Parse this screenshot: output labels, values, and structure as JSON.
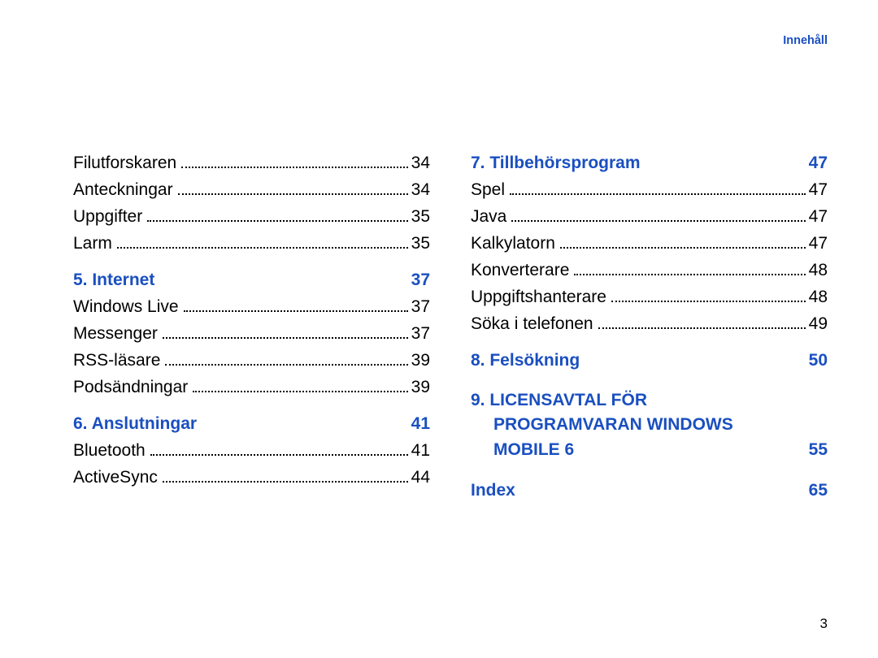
{
  "header": {
    "label": "Innehåll"
  },
  "footer": {
    "page_number": "3"
  },
  "left_column": [
    {
      "type": "entry",
      "label": "Filutforskaren",
      "page": "34"
    },
    {
      "type": "entry",
      "label": "Anteckningar",
      "page": "34"
    },
    {
      "type": "entry",
      "label": "Uppgifter",
      "page": "35"
    },
    {
      "type": "entry",
      "label": "Larm",
      "page": "35"
    },
    {
      "type": "section",
      "label": "5. Internet",
      "page": "37"
    },
    {
      "type": "entry",
      "label": "Windows Live",
      "page": "37"
    },
    {
      "type": "entry",
      "label": "Messenger",
      "page": "37"
    },
    {
      "type": "entry",
      "label": "RSS-läsare",
      "page": "39"
    },
    {
      "type": "entry",
      "label": "Podsändningar",
      "page": "39"
    },
    {
      "type": "section",
      "label": "6. Anslutningar",
      "page": "41"
    },
    {
      "type": "entry",
      "label": "Bluetooth",
      "page": "41"
    },
    {
      "type": "entry",
      "label": "ActiveSync",
      "page": "44"
    }
  ],
  "right_column": [
    {
      "type": "section",
      "label": "7. Tillbehörsprogram",
      "page": "47"
    },
    {
      "type": "entry",
      "label": "Spel",
      "page": "47"
    },
    {
      "type": "entry",
      "label": "Java",
      "page": "47"
    },
    {
      "type": "entry",
      "label": "Kalkylatorn",
      "page": "47"
    },
    {
      "type": "entry",
      "label": "Konverterare",
      "page": "48"
    },
    {
      "type": "entry",
      "label": "Uppgiftshanterare",
      "page": "48"
    },
    {
      "type": "entry",
      "label": "Söka i telefonen",
      "page": "49"
    },
    {
      "type": "section",
      "label": "8. Felsökning",
      "page": "50"
    },
    {
      "type": "section_multiline",
      "lines": [
        "9. LICENSAVTAL FÖR",
        "PROGRAMVARAN WINDOWS"
      ],
      "last_label": "MOBILE 6",
      "page": "55",
      "indent": true
    },
    {
      "type": "section",
      "label": "Index",
      "page": "65"
    }
  ]
}
